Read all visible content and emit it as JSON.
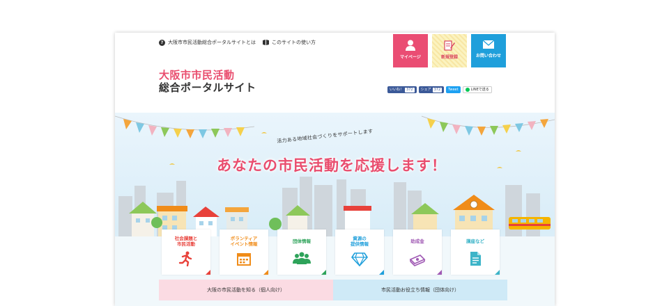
{
  "topnav": {
    "about": "大阪市市民活動総合ポータルサイトとは",
    "howto": "このサイトの使い方"
  },
  "logo": {
    "line1": "大阪市市民活動",
    "line2": "総合ポータルサイト"
  },
  "header_buttons": {
    "mypage": "マイページ",
    "register": "新規登録",
    "contact": "お問い合わせ"
  },
  "social": {
    "fb_like": "いいね！",
    "fb_like_count": "372",
    "fb_share": "シェア",
    "fb_share_count": "372",
    "tweet": "Tweet",
    "line": "LINEで送る"
  },
  "hero": {
    "subtitle": "活力ある地域社会づくりをサポートします",
    "title": "あなたの市民活動を応援します！"
  },
  "cards": [
    {
      "line1": "社会課題と",
      "line2": "市民活動",
      "icon": "running-person-icon",
      "color": "#e8413a"
    },
    {
      "line1": "ボランティア",
      "line2": "イベント情報",
      "icon": "calendar-icon",
      "color": "#f08c19"
    },
    {
      "line1": "団体情報",
      "line2": "",
      "icon": "group-icon",
      "color": "#2ea35a"
    },
    {
      "line1": "資源の",
      "line2": "提供情報",
      "icon": "diamond-icon",
      "color": "#1f9fdb"
    },
    {
      "line1": "助成金",
      "line2": "",
      "icon": "money-icon",
      "color": "#a05ab4"
    },
    {
      "line1": "講座など",
      "line2": "",
      "icon": "document-icon",
      "color": "#3cb4c8"
    }
  ],
  "categories": {
    "individual": "大阪の市民活動を知る（個人向け）",
    "group": "市民活動お役立ち情報（団体向け）"
  },
  "colors": {
    "brand_pink": "#e94d6e",
    "brand_blue": "#1f9fdb"
  }
}
